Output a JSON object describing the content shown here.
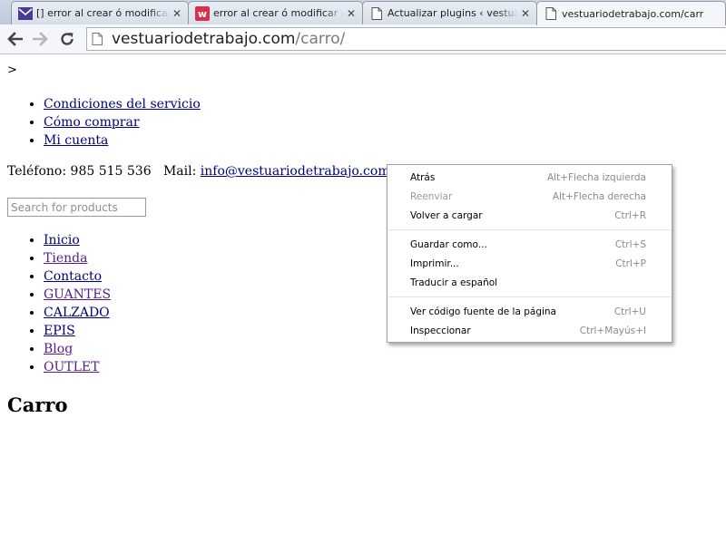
{
  "browser": {
    "tabs": [
      {
        "title": "[] error al crear ó modificar u",
        "favicon": "mail-icon",
        "active": false
      },
      {
        "title": "error al crear ó modificar un p",
        "favicon": "w-logo-icon",
        "active": false
      },
      {
        "title": "Actualizar plugins ‹ vestuario",
        "favicon": "page-icon",
        "active": false
      },
      {
        "title": "vestuariodetrabajo.com/carr",
        "favicon": "page-icon",
        "active": true
      }
    ],
    "url_host": "vestuariodetrabajo.com",
    "url_path": "/carro/"
  },
  "page": {
    "stray_text": ">",
    "top_menu": [
      "Condiciones del servicio",
      "Cómo comprar",
      "Mi cuenta"
    ],
    "contact": {
      "phone_label": "Teléfono:",
      "phone": "985 515 536",
      "mail_label": "Mail:",
      "email": "info@vestuariodetrabajo.com"
    },
    "search_placeholder": "Search for products",
    "main_menu": [
      "Inicio",
      "Tienda",
      "Contacto",
      "GUANTES",
      "CALZADO",
      "EPIS",
      "Blog",
      "OUTLET"
    ],
    "title": "Carro"
  },
  "context_menu": {
    "items": [
      {
        "label": "Atrás",
        "shortcut": "Alt+Flecha izquierda",
        "enabled": true
      },
      {
        "label": "Reenviar",
        "shortcut": "Alt+Flecha derecha",
        "enabled": false
      },
      {
        "label": "Volver a cargar",
        "shortcut": "Ctrl+R",
        "enabled": true
      },
      {
        "label": "Guardar como...",
        "shortcut": "Ctrl+S",
        "enabled": true
      },
      {
        "label": "Imprimir...",
        "shortcut": "Ctrl+P",
        "enabled": true
      },
      {
        "label": "Traducir a español",
        "shortcut": "",
        "enabled": true
      },
      {
        "label": "Ver código fuente de la página",
        "shortcut": "Ctrl+U",
        "enabled": true
      },
      {
        "label": "Inspeccionar",
        "shortcut": "Ctrl+Mayús+I",
        "enabled": true
      }
    ]
  },
  "colors": {
    "link": "#00007f",
    "visited_link": "#551a8b",
    "mail_favicon": "#4b3b8f",
    "w_favicon": "#d9304a"
  }
}
